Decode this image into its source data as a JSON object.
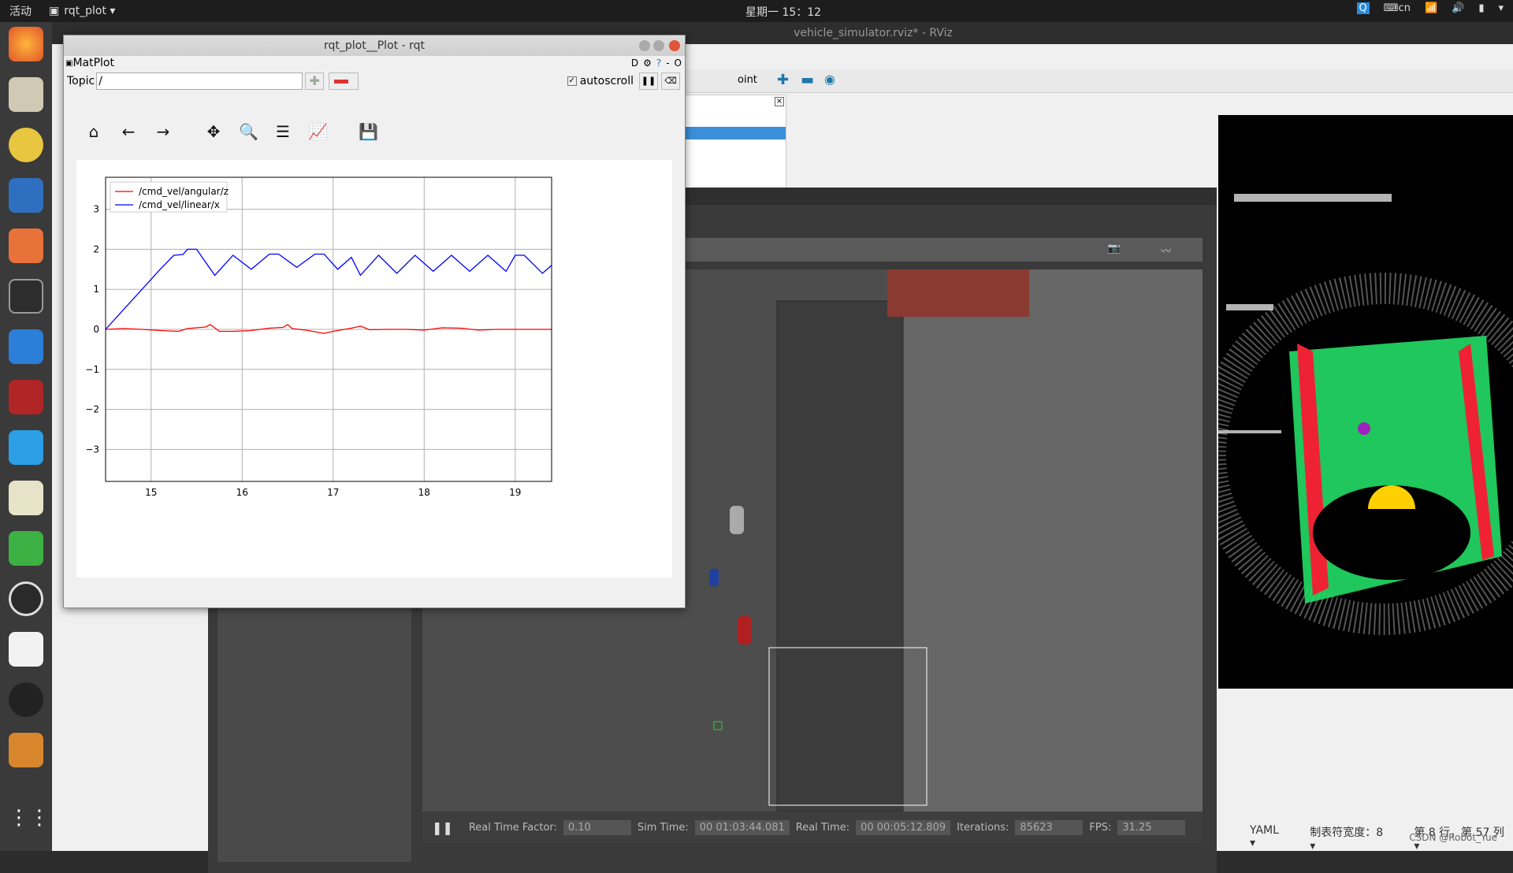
{
  "topbar": {
    "activities": "活动",
    "app": "rqt_plot ▾",
    "clock": "星期一 15：12",
    "lang": "cn"
  },
  "rviz": {
    "title": "vehicle_simulator.rviz* - RViz",
    "frag": "oint",
    "statusbar": [
      "YAML ▾",
      "制表符宽度：8 ▾",
      "第 8 行，第 57 列 ▾"
    ],
    "watermark": "CSDN @Robot_Yue"
  },
  "gazebo": {
    "status": [
      {
        "label": "Real Time Factor:",
        "value": "0.10"
      },
      {
        "label": "Sim Time:",
        "value": "00 01:03:44.081"
      },
      {
        "label": "Real Time:",
        "value": "00 00:05:12.809"
      },
      {
        "label": "Iterations:",
        "value": "85623"
      },
      {
        "label": "FPS:",
        "value": "31.25"
      }
    ]
  },
  "rqt": {
    "title": "rqt_plot__Plot - rqt",
    "plugin": "MatPlot",
    "topic_label": "Topic",
    "topic_value": "/",
    "autoscroll": "autoscroll",
    "icons": [
      "home-icon",
      "back-icon",
      "forward-icon",
      "pan-icon",
      "zoom-icon",
      "configure-icon",
      "edit-curves-icon",
      "save-icon"
    ]
  },
  "chart_data": {
    "type": "line",
    "xlim": [
      14.5,
      19.4
    ],
    "ylim": [
      -3.8,
      3.8
    ],
    "xticks": [
      "15",
      "16",
      "17",
      "18",
      "19"
    ],
    "yticks": [
      "3",
      "2",
      "1",
      "0",
      "−1",
      "−2",
      "−3"
    ],
    "grid": true,
    "legend": "top-left",
    "series": [
      {
        "name": "/cmd_vel/angular/z",
        "color": "#ff0000",
        "points": [
          [
            14.5,
            0
          ],
          [
            14.7,
            0.02
          ],
          [
            14.9,
            0
          ],
          [
            15.1,
            -0.03
          ],
          [
            15.3,
            -0.05
          ],
          [
            15.4,
            0.02
          ],
          [
            15.6,
            0.06
          ],
          [
            15.65,
            0.12
          ],
          [
            15.75,
            -0.05
          ],
          [
            15.9,
            -0.05
          ],
          [
            16.1,
            -0.03
          ],
          [
            16.3,
            0.03
          ],
          [
            16.45,
            0.05
          ],
          [
            16.5,
            0.12
          ],
          [
            16.55,
            0.02
          ],
          [
            16.7,
            -0.02
          ],
          [
            16.9,
            -0.1
          ],
          [
            17.0,
            -0.05
          ],
          [
            17.2,
            0.03
          ],
          [
            17.3,
            0.08
          ],
          [
            17.4,
            -0.01
          ],
          [
            17.6,
            0
          ],
          [
            17.8,
            0
          ],
          [
            18.0,
            -0.02
          ],
          [
            18.2,
            0.04
          ],
          [
            18.4,
            0.03
          ],
          [
            18.6,
            -0.02
          ],
          [
            18.8,
            0
          ],
          [
            19.0,
            0
          ],
          [
            19.2,
            0
          ],
          [
            19.4,
            0
          ]
        ]
      },
      {
        "name": "/cmd_vel/linear/x",
        "color": "#0000ff",
        "points": [
          [
            14.5,
            0
          ],
          [
            14.7,
            0.5
          ],
          [
            14.9,
            1.0
          ],
          [
            15.1,
            1.5
          ],
          [
            15.25,
            1.85
          ],
          [
            15.35,
            1.87
          ],
          [
            15.4,
            2.0
          ],
          [
            15.5,
            2.0
          ],
          [
            15.7,
            1.35
          ],
          [
            15.9,
            1.85
          ],
          [
            16.1,
            1.5
          ],
          [
            16.3,
            1.88
          ],
          [
            16.4,
            1.88
          ],
          [
            16.6,
            1.55
          ],
          [
            16.8,
            1.88
          ],
          [
            16.9,
            1.88
          ],
          [
            17.05,
            1.5
          ],
          [
            17.2,
            1.8
          ],
          [
            17.3,
            1.35
          ],
          [
            17.5,
            1.85
          ],
          [
            17.7,
            1.4
          ],
          [
            17.9,
            1.85
          ],
          [
            18.1,
            1.45
          ],
          [
            18.3,
            1.85
          ],
          [
            18.5,
            1.45
          ],
          [
            18.7,
            1.85
          ],
          [
            18.9,
            1.45
          ],
          [
            19.0,
            1.85
          ],
          [
            19.1,
            1.85
          ],
          [
            19.3,
            1.4
          ],
          [
            19.4,
            1.6
          ]
        ]
      }
    ]
  }
}
